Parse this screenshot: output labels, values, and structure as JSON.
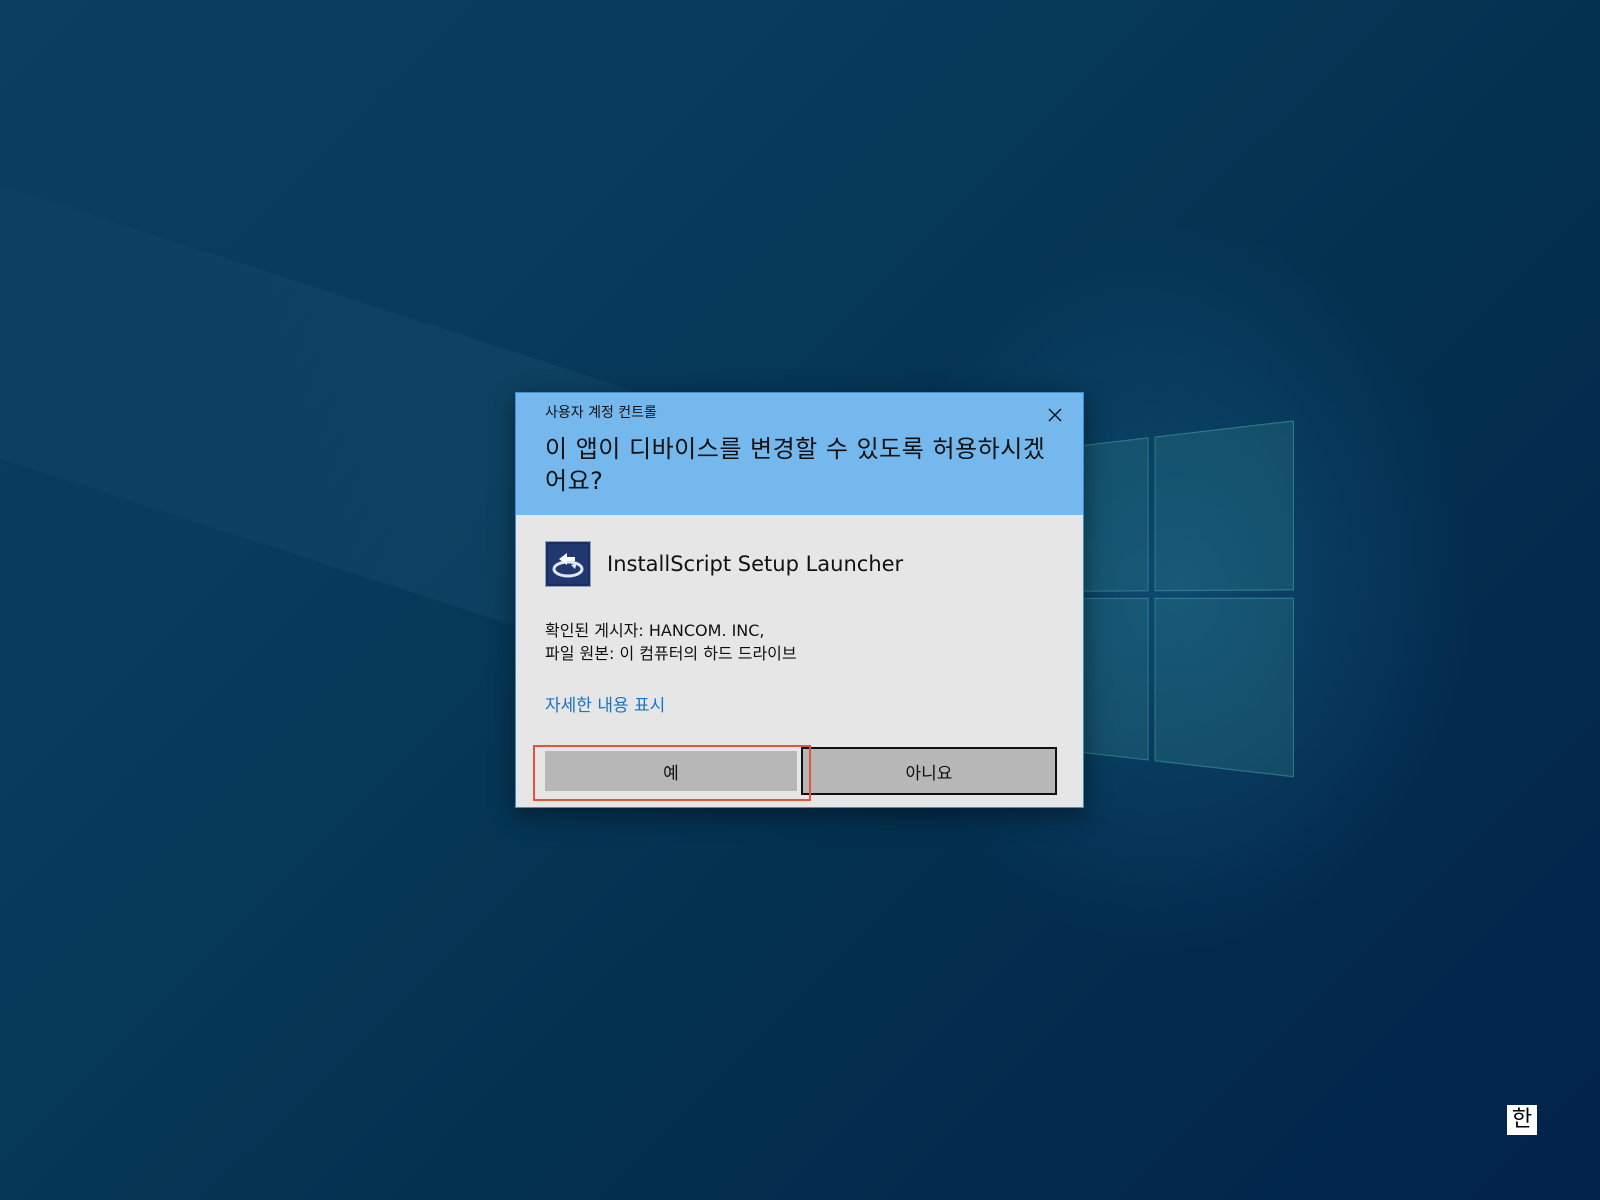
{
  "dialog": {
    "caption": "사용자 계정 컨트롤",
    "question": "이 앱이 디바이스를 변경할 수 있도록 허용하시겠어요?",
    "app_name": "InstallScript Setup Launcher",
    "publisher_line": "확인된 게시자: HANCOM. INC,",
    "origin_line": "파일 원본: 이 컴퓨터의 하드 드라이브",
    "details_link": "자세한 내용 표시",
    "yes_label": "예",
    "no_label": "아니요",
    "close_icon": "close-icon",
    "app_icon": "installshield-icon"
  },
  "taskbar": {
    "ime_indicator": "한"
  },
  "colors": {
    "header_bg": "#74b8ee",
    "body_bg": "#e6e6e6",
    "link": "#1a73c9",
    "button_bg": "#b7b7b7",
    "focus_ring": "#e2553a"
  }
}
